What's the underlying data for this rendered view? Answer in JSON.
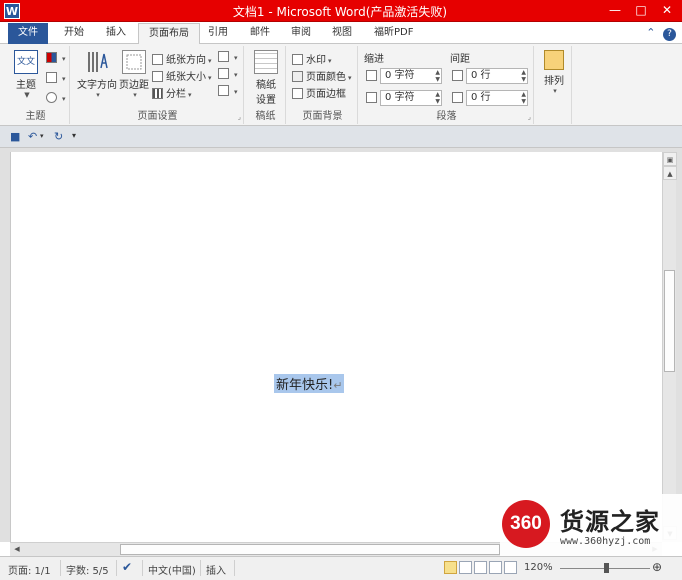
{
  "window": {
    "app_icon": "W",
    "title": "文档1 - Microsoft Word(产品激活失败)",
    "minimize": "—",
    "maximize": "□",
    "close": "✕"
  },
  "tabs": [
    {
      "label": "文件",
      "type": "file"
    },
    {
      "label": "开始"
    },
    {
      "label": "插入"
    },
    {
      "label": "页面布局",
      "active": true
    },
    {
      "label": "引用"
    },
    {
      "label": "邮件"
    },
    {
      "label": "审阅"
    },
    {
      "label": "视图"
    },
    {
      "label": "福昕PDF"
    }
  ],
  "help": {
    "collapse": "⌃",
    "help": "?"
  },
  "ribbon": {
    "theme_group": {
      "label": "主题",
      "theme_btn": "主题",
      "theme_icon_text": "文文"
    },
    "page_setup_group": {
      "label": "页面设置",
      "text_direction": "文字方向",
      "margins": "页边距",
      "orientation": "纸张方向",
      "size": "纸张大小",
      "columns": "分栏"
    },
    "manuscript_group": {
      "label": "稿纸",
      "btn_line1": "稿纸",
      "btn_line2": "设置"
    },
    "page_bg_group": {
      "label": "页面背景",
      "watermark": "水印",
      "page_color": "页面颜色",
      "page_borders": "页面边框"
    },
    "paragraph_group": {
      "label": "段落",
      "indent_label": "缩进",
      "spacing_label": "间距",
      "indent_left": "0 字符",
      "indent_right": "0 字符",
      "spacing_before": "0 行",
      "spacing_after": "0 行"
    },
    "arrange_group": {
      "label": "排列"
    }
  },
  "document": {
    "text": "新年快乐!",
    "para_mark": "↵"
  },
  "statusbar": {
    "page": "页面: 1/1",
    "words": "字数: 5/5",
    "language": "中文(中国)",
    "mode": "插入",
    "zoom": "120%"
  },
  "watermark": {
    "logo": "360",
    "title": "货源之家",
    "url": "www.360hyzj.com"
  },
  "colors": {
    "titlebar": "#e60000",
    "file_tab": "#2b579a",
    "selection": "#a9c7ec",
    "logo_red": "#d71920"
  }
}
